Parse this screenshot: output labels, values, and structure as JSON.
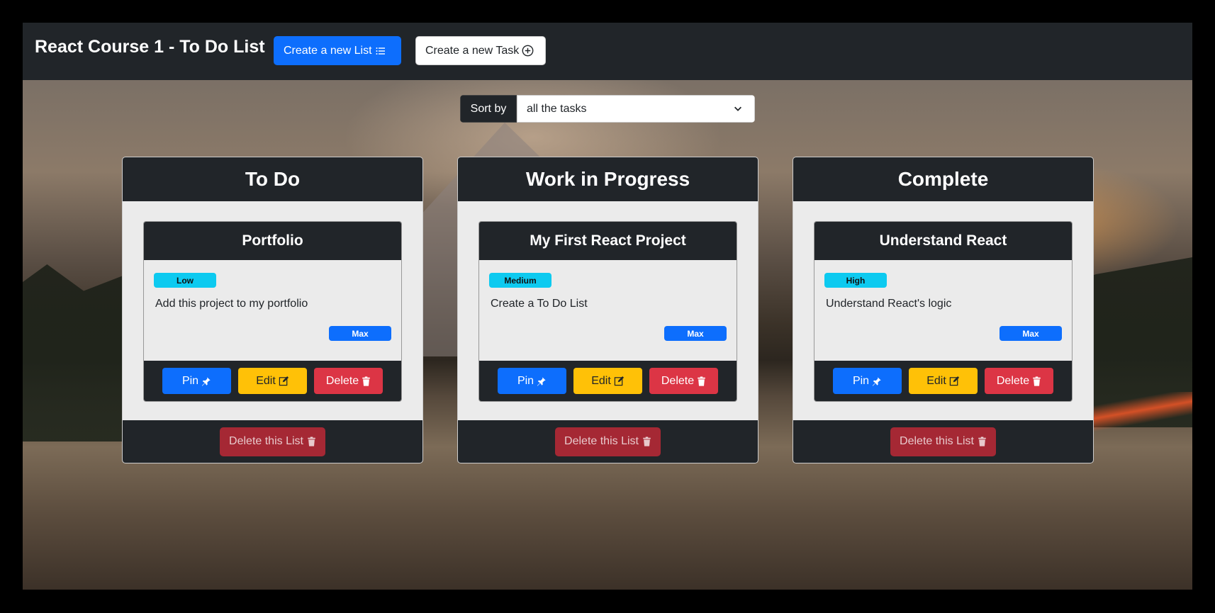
{
  "navbar": {
    "brand": "React Course 1 - To Do List",
    "create_list_label": "Create a new List",
    "create_task_label": "Create a new Task",
    "create_list_icon": "list-icon",
    "create_task_icon": "plus-circle-icon"
  },
  "sort": {
    "label": "Sort by",
    "selected": "all the tasks"
  },
  "lists": [
    {
      "title": "To Do",
      "delete_label": "Delete this List",
      "tasks": [
        {
          "title": "Portfolio",
          "priority": "Low",
          "description": "Add this project to my portfolio",
          "assignee": "Max",
          "pin_label": "Pin",
          "edit_label": "Edit",
          "delete_label": "Delete"
        }
      ]
    },
    {
      "title": "Work in Progress",
      "delete_label": "Delete this List",
      "tasks": [
        {
          "title": "My First React Project",
          "priority": "Medium",
          "description": "Create a To Do List",
          "assignee": "Max",
          "pin_label": "Pin",
          "edit_label": "Edit",
          "delete_label": "Delete"
        }
      ]
    },
    {
      "title": "Complete",
      "delete_label": "Delete this List",
      "tasks": [
        {
          "title": "Understand React",
          "priority": "High",
          "description": "Understand React's logic",
          "assignee": "Max",
          "pin_label": "Pin",
          "edit_label": "Edit",
          "delete_label": "Delete"
        }
      ]
    }
  ],
  "colors": {
    "navbar_bg": "#212529",
    "primary": "#0d6efd",
    "warning": "#ffc107",
    "danger": "#dc3545",
    "info": "#0dcaf0"
  }
}
